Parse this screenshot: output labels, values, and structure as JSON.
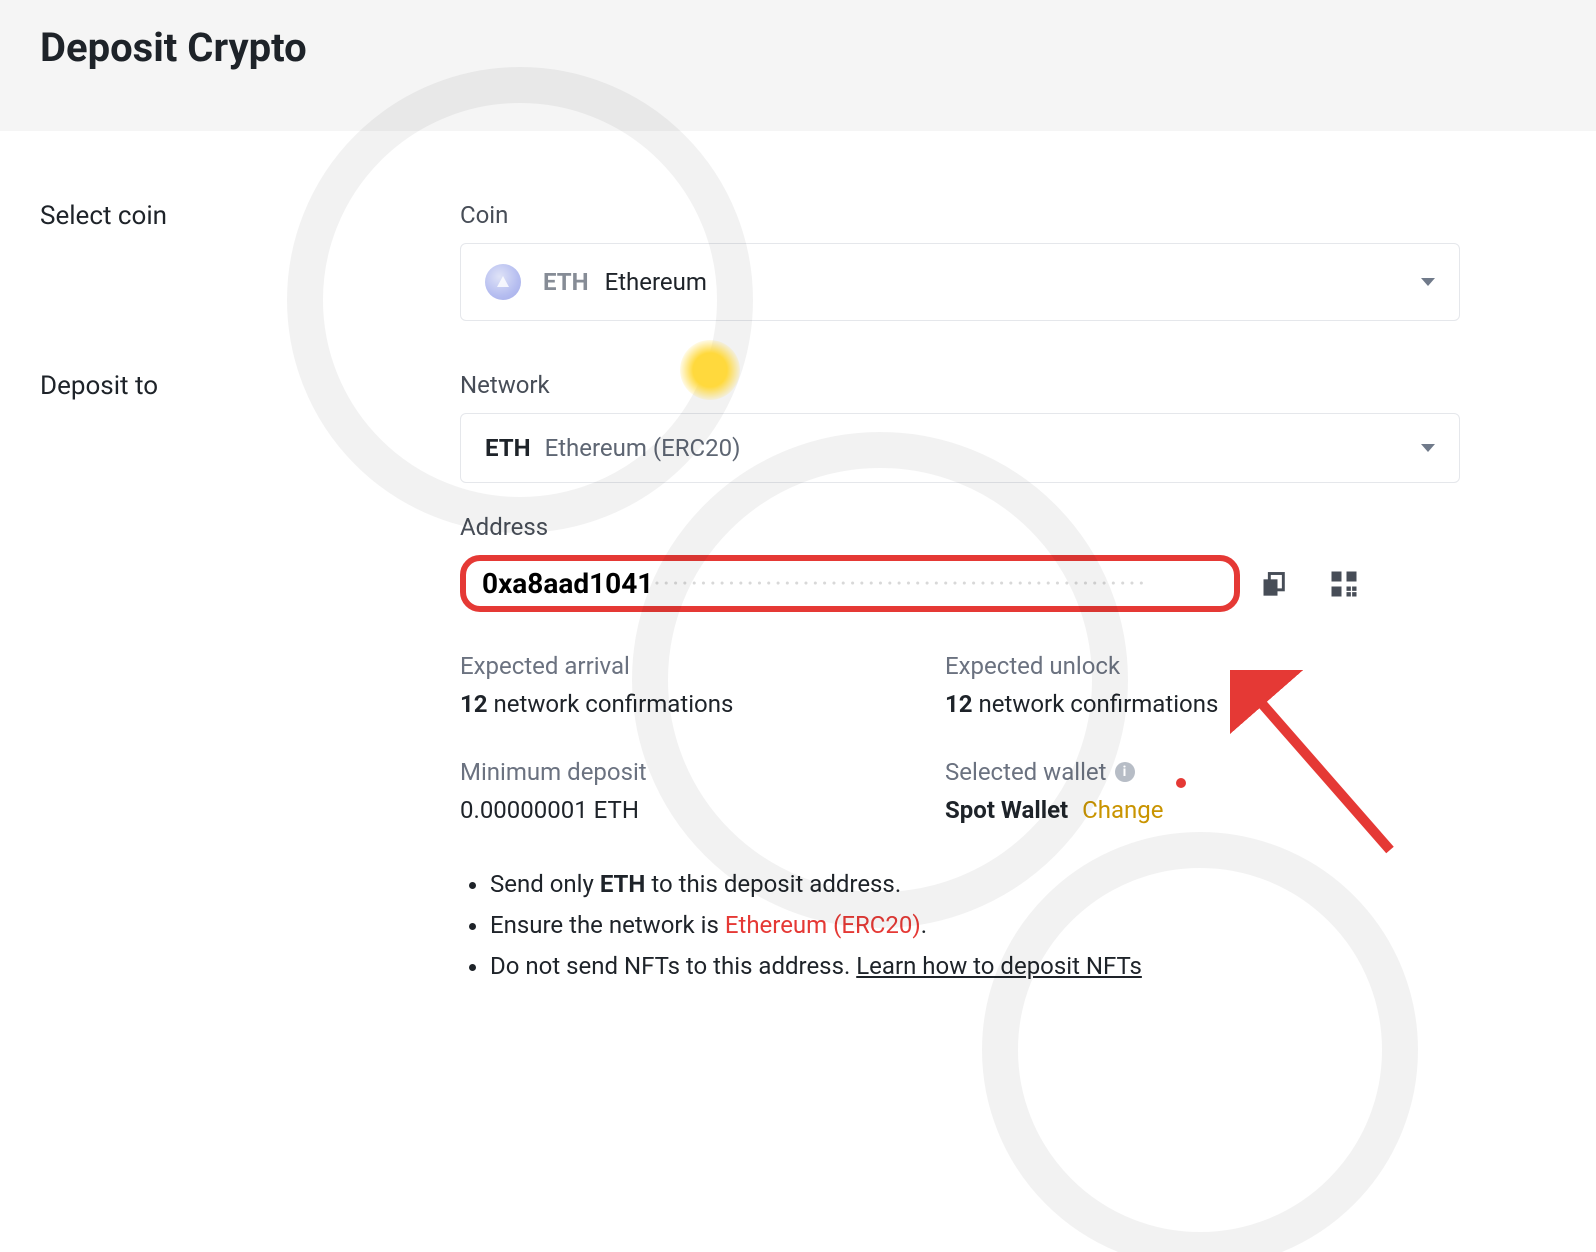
{
  "header": {
    "title": "Deposit Crypto"
  },
  "select_coin": {
    "label": "Select coin",
    "field_label": "Coin",
    "symbol": "ETH",
    "name": "Ethereum"
  },
  "deposit_to": {
    "label": "Deposit to",
    "network_label": "Network",
    "network_symbol": "ETH",
    "network_name": "Ethereum (ERC20)",
    "address_label": "Address",
    "address_visible": "0xa8aad1041",
    "address_hidden": "·····················································"
  },
  "details": {
    "expected_arrival": {
      "label": "Expected arrival",
      "count": "12",
      "suffix": "network confirmations"
    },
    "expected_unlock": {
      "label": "Expected unlock",
      "count": "12",
      "suffix": "network confirmations"
    },
    "minimum_deposit": {
      "label": "Minimum deposit",
      "value": "0.00000001 ETH"
    },
    "selected_wallet": {
      "label": "Selected wallet",
      "value": "Spot Wallet",
      "change": "Change"
    }
  },
  "notes": {
    "line1_pre": "Send only ",
    "line1_coin": "ETH",
    "line1_post": " to this deposit address.",
    "line2_pre": "Ensure the network is ",
    "line2_net": "Ethereum (ERC20)",
    "line2_post": ".",
    "line3_pre": "Do not send NFTs to this address. ",
    "line3_link": "Learn how to deposit NFTs"
  }
}
